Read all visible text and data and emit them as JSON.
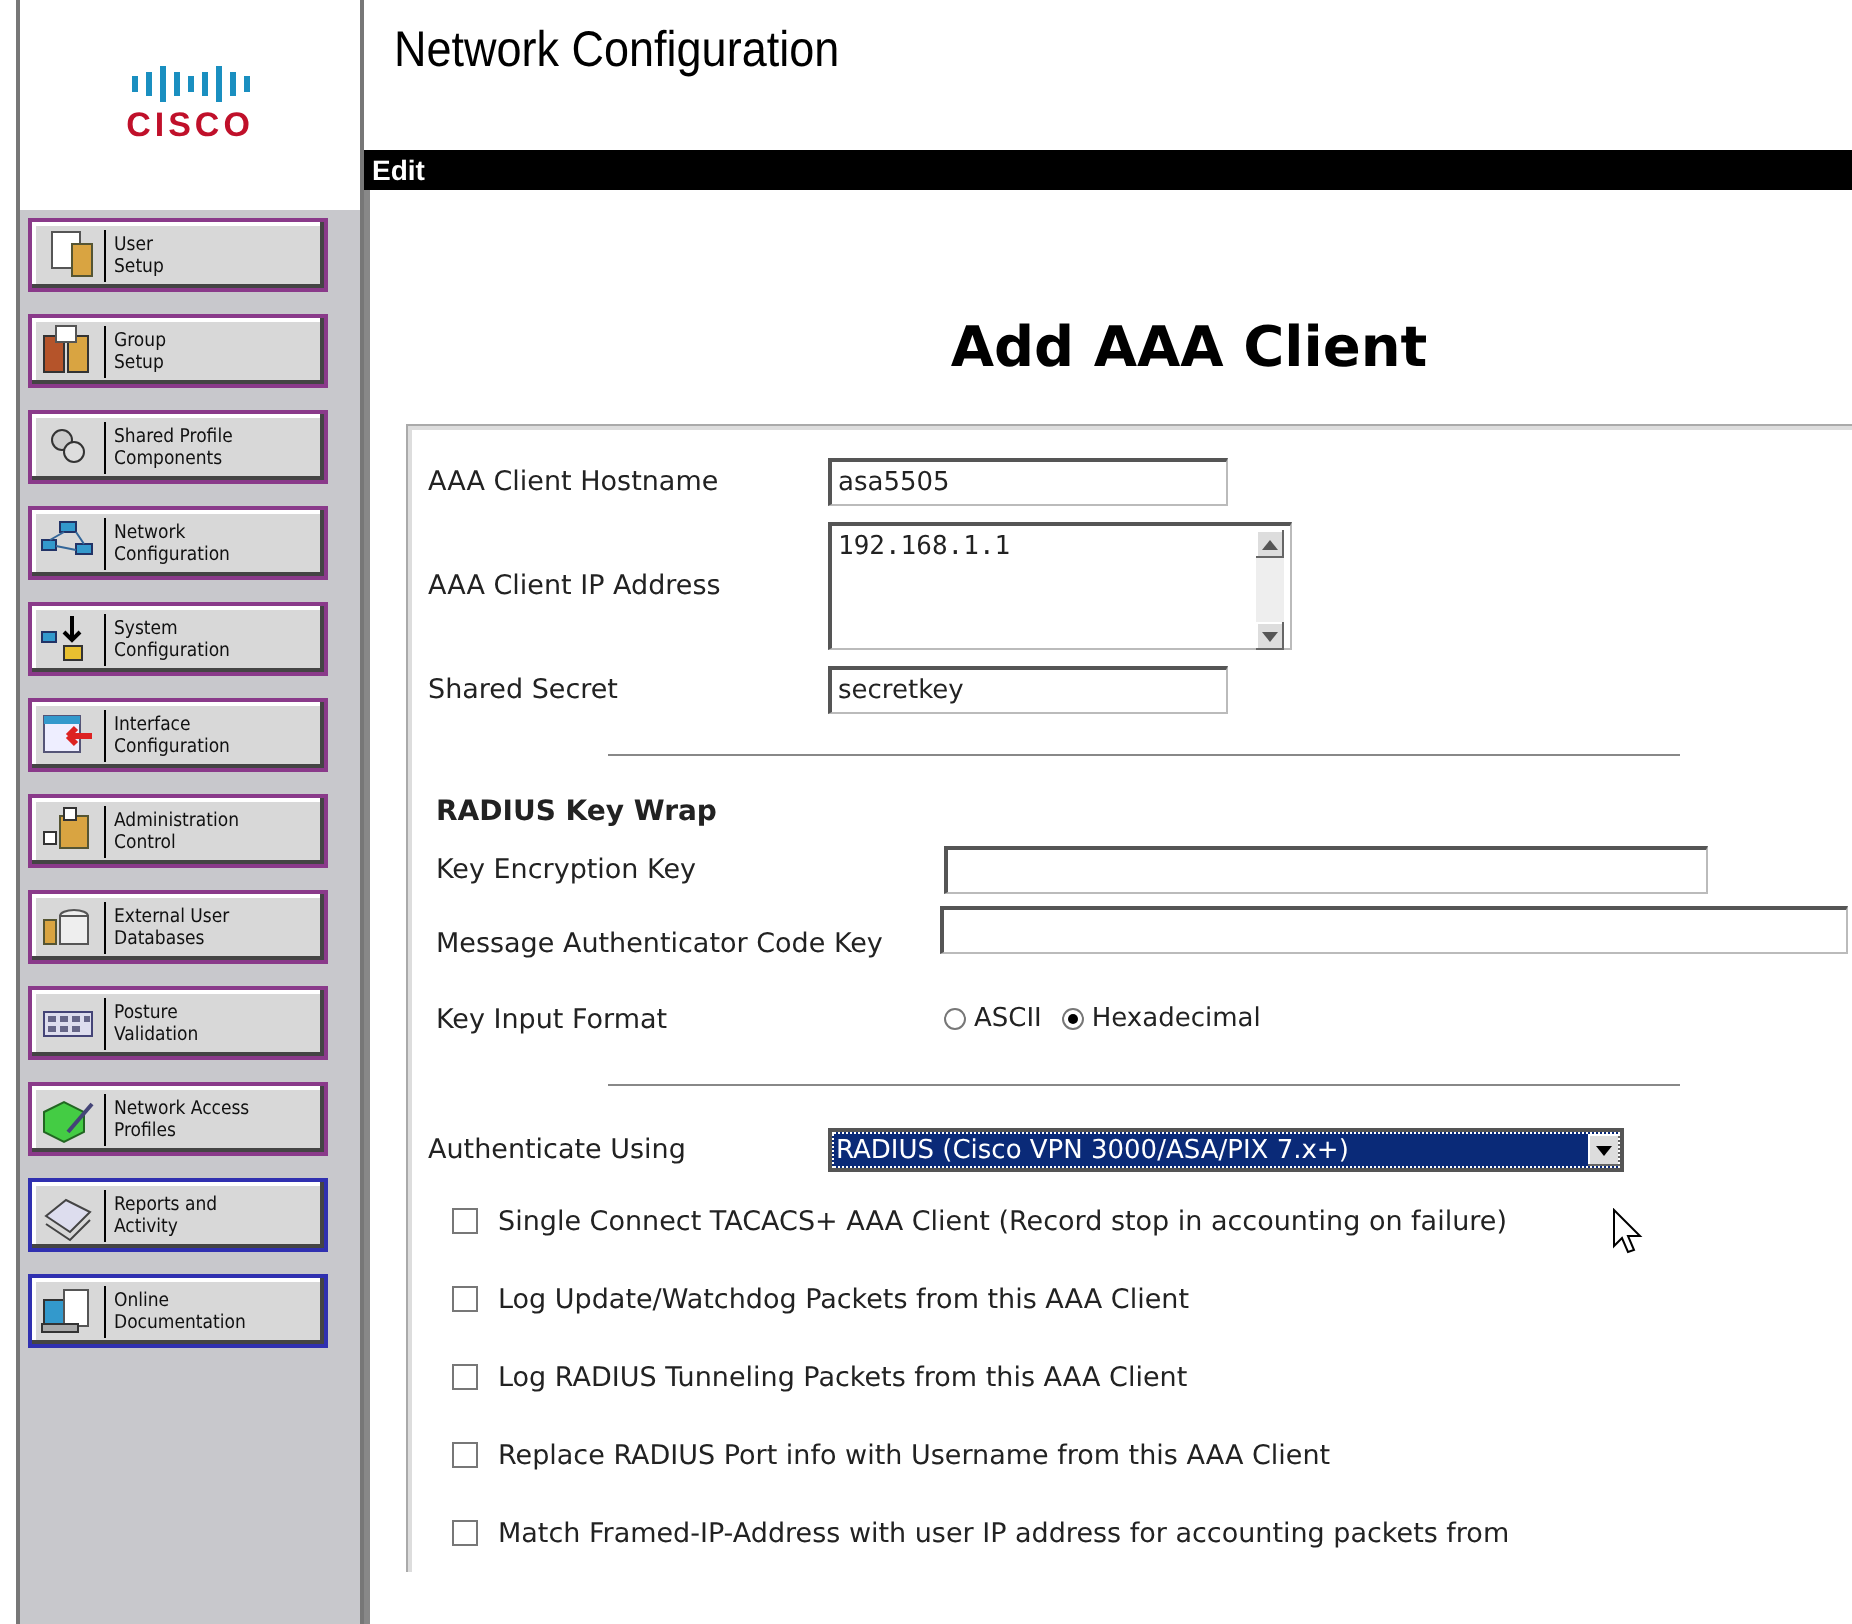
{
  "logo": {
    "text": "CISCO"
  },
  "sidebar": {
    "items": [
      {
        "label": "User\nSetup",
        "visited": true
      },
      {
        "label": "Group\nSetup",
        "visited": true
      },
      {
        "label": "Shared Profile\nComponents",
        "visited": true
      },
      {
        "label": "Network\nConfiguration",
        "visited": true
      },
      {
        "label": "System\nConfiguration",
        "visited": true
      },
      {
        "label": "Interface\nConfiguration",
        "visited": true
      },
      {
        "label": "Administration\nControl",
        "visited": true
      },
      {
        "label": "External User\nDatabases",
        "visited": true
      },
      {
        "label": "Posture\nValidation",
        "visited": true
      },
      {
        "label": "Network Access\nProfiles",
        "visited": true
      },
      {
        "label": "Reports and\nActivity",
        "visited": false
      },
      {
        "label": "Online\nDocumentation",
        "visited": false
      }
    ]
  },
  "header": {
    "title": "Network Configuration"
  },
  "edit_bar": {
    "label": "Edit"
  },
  "page_title": "Add AAA Client",
  "form": {
    "hostname": {
      "label": "AAA Client Hostname",
      "value": "asa5505"
    },
    "ip_address": {
      "label": "AAA Client IP Address",
      "value": "192.168.1.1"
    },
    "shared_secret": {
      "label": "Shared Secret",
      "value": "secretkey"
    },
    "key_wrap": {
      "heading": "RADIUS Key Wrap",
      "key_encryption_key": {
        "label": "Key Encryption Key"
      },
      "mac_key": {
        "label": "Message Authenticator Code Key"
      },
      "key_input_format": {
        "label": "Key Input Format",
        "options": [
          {
            "label": "ASCII",
            "selected": false
          },
          {
            "label": "Hexadecimal",
            "selected": true
          }
        ]
      }
    },
    "authenticate_using": {
      "label": "Authenticate Using",
      "value": "RADIUS (Cisco VPN 3000/ASA/PIX 7.x+)"
    },
    "options": [
      {
        "label": "Single Connect TACACS+ AAA Client (Record stop in accounting on failure)",
        "checked": false
      },
      {
        "label": "Log Update/Watchdog Packets from this AAA Client",
        "checked": false
      },
      {
        "label": "Log RADIUS Tunneling Packets from this AAA Client",
        "checked": false
      },
      {
        "label": "Replace RADIUS Port info with Username from this AAA Client",
        "checked": false
      },
      {
        "label": "Match Framed-IP-Address with user IP address for accounting packets from",
        "checked": false
      }
    ]
  }
}
